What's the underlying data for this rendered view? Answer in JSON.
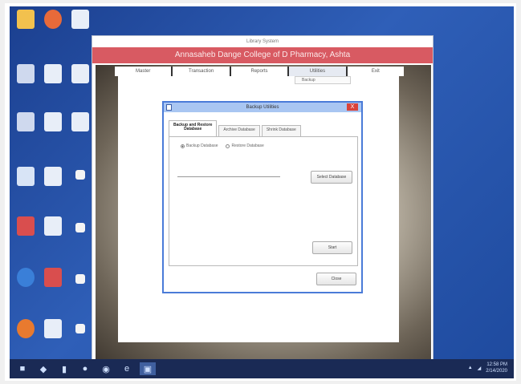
{
  "app": {
    "window_title": "Library System",
    "banner": "Annasaheb Dange College of D Pharmacy, Ashta",
    "menu": [
      "Master",
      "Transaction",
      "Reports",
      "Utilities",
      "Exit"
    ],
    "active_menu_index": 3,
    "submenu_item": "Backup"
  },
  "dialog": {
    "title": "Backup Utilities",
    "close_glyph": "X",
    "tabs": [
      "Backup and Restore\nDatabase",
      "Archive Database",
      "Shrink Database"
    ],
    "radio_backup": "Backup Database",
    "radio_restore": "Restore Database",
    "path_value": "",
    "select_button": "Select Database",
    "start_button": "Start",
    "close_button": "Close"
  },
  "taskbar": {
    "time": "12:58 PM",
    "date": "2/14/2020"
  },
  "colors": {
    "banner": "#d85a62",
    "desktop": "#2f5fb8",
    "dialog_border": "#4a7bd8",
    "close": "#d9433b"
  }
}
